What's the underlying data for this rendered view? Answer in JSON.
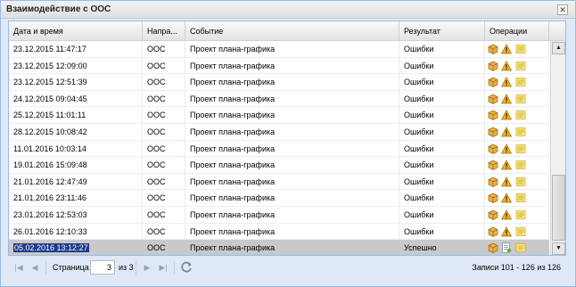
{
  "window": {
    "title": "Взаимодействие с ООС",
    "close_glyph": "✕"
  },
  "columns": {
    "date": "Дата и время",
    "direction": "Напра...",
    "event": "Событие",
    "result": "Результат",
    "operations": "Операции"
  },
  "rows": [
    {
      "date": "23.12.2015 11:47:17",
      "direction": "ООС",
      "event": "Проект плана-графика",
      "result": "Ошибки",
      "ops": [
        "box-icon",
        "warning-icon",
        "note-icon"
      ]
    },
    {
      "date": "23.12.2015 12:09:00",
      "direction": "ООС",
      "event": "Проект плана-графика",
      "result": "Ошибки",
      "ops": [
        "box-icon",
        "warning-icon",
        "note-icon"
      ]
    },
    {
      "date": "23.12.2015 12:51:39",
      "direction": "ООС",
      "event": "Проект плана-графика",
      "result": "Ошибки",
      "ops": [
        "box-icon",
        "warning-icon",
        "note-icon"
      ]
    },
    {
      "date": "24.12.2015 09:04:45",
      "direction": "ООС",
      "event": "Проект плана-графика",
      "result": "Ошибки",
      "ops": [
        "box-icon",
        "warning-icon",
        "note-icon"
      ]
    },
    {
      "date": "25.12.2015 11:01:11",
      "direction": "ООС",
      "event": "Проект плана-графика",
      "result": "Ошибки",
      "ops": [
        "box-icon",
        "warning-icon",
        "note-icon"
      ]
    },
    {
      "date": "28.12.2015 10:08:42",
      "direction": "ООС",
      "event": "Проект плана-графика",
      "result": "Ошибки",
      "ops": [
        "box-icon",
        "warning-icon",
        "note-icon"
      ]
    },
    {
      "date": "11.01.2016 10:03:14",
      "direction": "ООС",
      "event": "Проект плана-графика",
      "result": "Ошибки",
      "ops": [
        "box-icon",
        "warning-icon",
        "note-icon"
      ]
    },
    {
      "date": "19.01.2016 15:09:48",
      "direction": "ООС",
      "event": "Проект плана-графика",
      "result": "Ошибки",
      "ops": [
        "box-icon",
        "warning-icon",
        "note-icon"
      ]
    },
    {
      "date": "21.01.2016 12:47:49",
      "direction": "ООС",
      "event": "Проект плана-графика",
      "result": "Ошибки",
      "ops": [
        "box-icon",
        "warning-icon",
        "note-icon"
      ]
    },
    {
      "date": "21.01.2016 23:11:46",
      "direction": "ООС",
      "event": "Проект плана-графика",
      "result": "Ошибки",
      "ops": [
        "box-icon",
        "warning-icon",
        "note-icon"
      ]
    },
    {
      "date": "23.01.2016 12:53:03",
      "direction": "ООС",
      "event": "Проект плана-графика",
      "result": "Ошибки",
      "ops": [
        "box-icon",
        "warning-icon",
        "note-icon"
      ]
    },
    {
      "date": "26.01.2016 12:10:33",
      "direction": "ООС",
      "event": "Проект плана-графика",
      "result": "Ошибки",
      "ops": [
        "box-icon",
        "warning-icon",
        "note-icon"
      ]
    },
    {
      "date": "05.02.2016 13:12:27",
      "direction": "ООС",
      "event": "Проект плана-графика",
      "result": "Успешно",
      "selected": true,
      "ops": [
        "box-icon",
        "document-icon",
        "note-icon"
      ]
    }
  ],
  "pager": {
    "page_label": "Страница",
    "page_value": "3",
    "of_label": "из 3",
    "status": "Записи 101 - 126 из 126"
  },
  "colors": {
    "selected_row": "#c9c9c9",
    "selected_text_bg": "#1f3a8a",
    "window_border": "#99bbe8"
  }
}
